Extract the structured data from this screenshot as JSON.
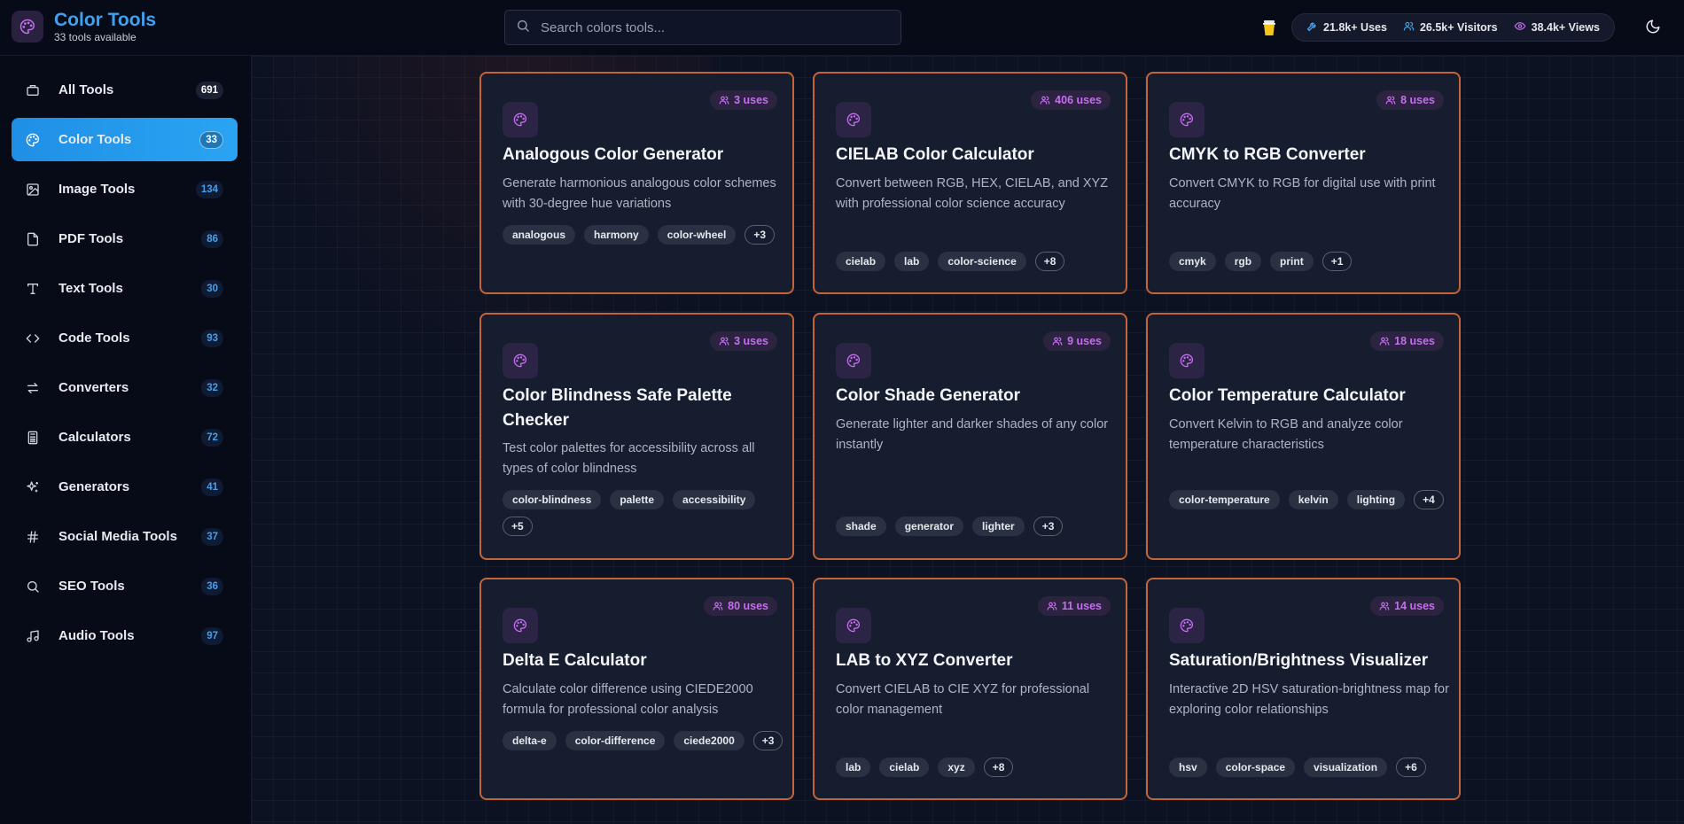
{
  "brand": {
    "title": "Color Tools",
    "subtitle": "33 tools available"
  },
  "search": {
    "placeholder": "Search colors tools..."
  },
  "stats": {
    "uses": "21.8k+ Uses",
    "visitors": "26.5k+ Visitors",
    "views": "38.4k+ Views"
  },
  "sidebar": {
    "items": [
      {
        "label": "All Tools",
        "count": "691",
        "icon": "grid-icon"
      },
      {
        "label": "Color Tools",
        "count": "33",
        "icon": "palette-icon",
        "active": true
      },
      {
        "label": "Image Tools",
        "count": "134",
        "icon": "image-icon"
      },
      {
        "label": "PDF Tools",
        "count": "86",
        "icon": "file-icon"
      },
      {
        "label": "Text Tools",
        "count": "30",
        "icon": "type-icon"
      },
      {
        "label": "Code Tools",
        "count": "93",
        "icon": "code-icon"
      },
      {
        "label": "Converters",
        "count": "32",
        "icon": "swap-icon"
      },
      {
        "label": "Calculators",
        "count": "72",
        "icon": "calculator-icon"
      },
      {
        "label": "Generators",
        "count": "41",
        "icon": "sparkles-icon"
      },
      {
        "label": "Social Media Tools",
        "count": "37",
        "icon": "hash-icon"
      },
      {
        "label": "SEO Tools",
        "count": "36",
        "icon": "search-icon"
      },
      {
        "label": "Audio Tools",
        "count": "97",
        "icon": "music-icon"
      }
    ]
  },
  "cards": [
    {
      "title": "Analogous Color Generator",
      "uses": "3 uses",
      "desc": "Generate harmonious analogous color schemes with 30-degree hue variations",
      "tags": [
        "analogous",
        "harmony",
        "color-wheel"
      ],
      "more": "+3"
    },
    {
      "title": "CIELAB Color Calculator",
      "uses": "406 uses",
      "desc": "Convert between RGB, HEX, CIELAB, and XYZ with professional color science accuracy",
      "tags": [
        "cielab",
        "lab",
        "color-science"
      ],
      "more": "+8"
    },
    {
      "title": "CMYK to RGB Converter",
      "uses": "8 uses",
      "desc": "Convert CMYK to RGB for digital use with print accuracy",
      "tags": [
        "cmyk",
        "rgb",
        "print"
      ],
      "more": "+1"
    },
    {
      "title": "Color Blindness Safe Palette Checker",
      "uses": "3 uses",
      "desc": "Test color palettes for accessibility across all types of color blindness",
      "tags": [
        "color-blindness",
        "palette",
        "accessibility"
      ],
      "more": "+5"
    },
    {
      "title": "Color Shade Generator",
      "uses": "9 uses",
      "desc": "Generate lighter and darker shades of any color instantly",
      "tags": [
        "shade",
        "generator",
        "lighter"
      ],
      "more": "+3"
    },
    {
      "title": "Color Temperature Calculator",
      "uses": "18 uses",
      "desc": "Convert Kelvin to RGB and analyze color temperature characteristics",
      "tags": [
        "color-temperature",
        "kelvin",
        "lighting"
      ],
      "more": "+4"
    },
    {
      "title": "Delta E Calculator",
      "uses": "80 uses",
      "desc": "Calculate color difference using CIEDE2000 formula for professional color analysis",
      "tags": [
        "delta-e",
        "color-difference",
        "ciede2000"
      ],
      "more": "+3"
    },
    {
      "title": "LAB to XYZ Converter",
      "uses": "11 uses",
      "desc": "Convert CIELAB to CIE XYZ for professional color management",
      "tags": [
        "lab",
        "cielab",
        "xyz"
      ],
      "more": "+8"
    },
    {
      "title": "Saturation/Brightness Visualizer",
      "uses": "14 uses",
      "desc": "Interactive 2D HSV saturation-brightness map for exploring color relationships",
      "tags": [
        "hsv",
        "color-space",
        "visualization"
      ],
      "more": "+6"
    }
  ],
  "colors": {
    "accent": "#2aa4f2",
    "card_border": "#c2653a",
    "uses_text": "#c56ef0"
  }
}
